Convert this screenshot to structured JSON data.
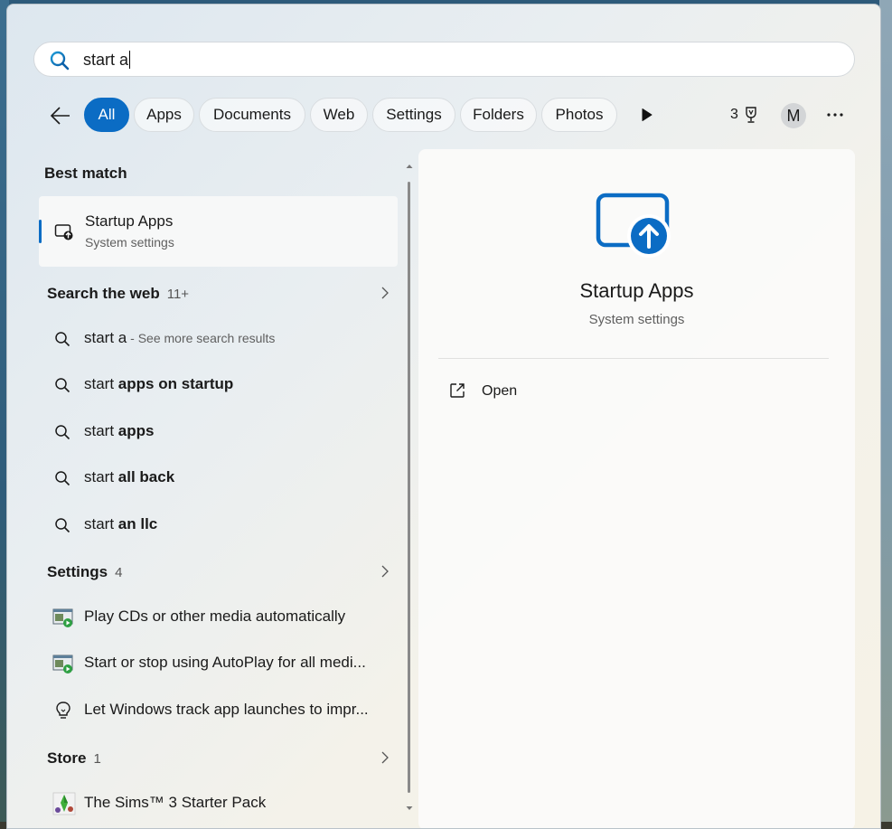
{
  "search": {
    "query": "start a"
  },
  "tabs": [
    {
      "label": "All",
      "active": true
    },
    {
      "label": "Apps"
    },
    {
      "label": "Documents"
    },
    {
      "label": "Web"
    },
    {
      "label": "Settings"
    },
    {
      "label": "Folders"
    },
    {
      "label": "Photos"
    }
  ],
  "header": {
    "rewards_points": "3",
    "avatar_initial": "M"
  },
  "best_match": {
    "heading": "Best match",
    "title": "Startup Apps",
    "subtitle": "System settings"
  },
  "web": {
    "heading": "Search the web",
    "count": "11+",
    "items": [
      {
        "prefix": "start a",
        "bold": "",
        "hint": " - See more search results"
      },
      {
        "prefix": "start ",
        "bold": "apps on startup",
        "hint": ""
      },
      {
        "prefix": "start ",
        "bold": "apps",
        "hint": ""
      },
      {
        "prefix": "start ",
        "bold": "all back",
        "hint": ""
      },
      {
        "prefix": "start ",
        "bold": "an llc",
        "hint": ""
      }
    ]
  },
  "settings": {
    "heading": "Settings",
    "count": "4",
    "items": [
      {
        "label": "Play CDs or other media automatically",
        "icon": "autoplay-icon"
      },
      {
        "label": "Start or stop using AutoPlay for all medi...",
        "icon": "autoplay-icon"
      },
      {
        "label": "Let Windows track app launches to impr...",
        "icon": "lightbulb-icon"
      }
    ]
  },
  "store": {
    "heading": "Store",
    "count": "1",
    "items": [
      {
        "label": "The Sims™ 3 Starter Pack",
        "icon": "sims-game-icon"
      }
    ]
  },
  "preview": {
    "title": "Startup Apps",
    "subtitle": "System settings",
    "open_label": "Open"
  },
  "colors": {
    "accent": "#0b6cc4"
  }
}
